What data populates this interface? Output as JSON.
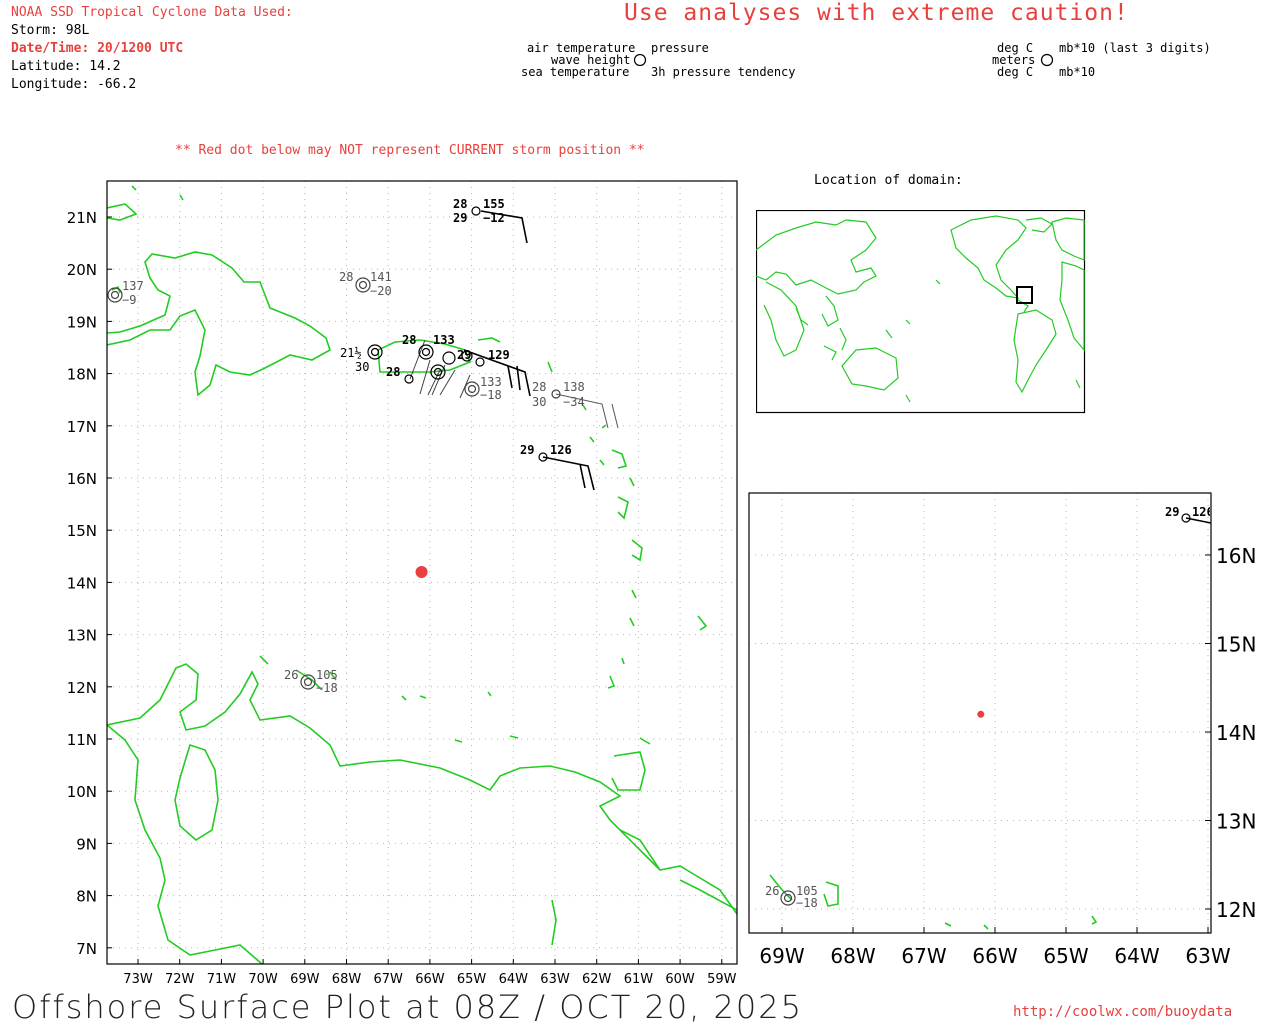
{
  "header": {
    "data_used": "NOAA SSD Tropical Cyclone Data Used:",
    "storm": "Storm: 98L",
    "datetime": "Date/Time: 20/1200 UTC",
    "latitude": "Latitude: 14.2",
    "longitude": "Longitude: -66.2",
    "caution": "Use analyses with extreme caution!"
  },
  "legend": {
    "air_temperature": "air temperature",
    "pressure": "pressure",
    "wave_height": "wave height",
    "sea_temperature": "sea temperature",
    "pressure_tendency": "3h pressure tendency",
    "deg_c_1": "deg C",
    "mb10_last3": "mb*10 (last 3 digits)",
    "meters": "meters",
    "deg_c_2": "deg C",
    "mb10": "mb*10"
  },
  "notice": "** Red dot below may NOT represent CURRENT storm position **",
  "inset_title": "Location of domain:",
  "main_map": {
    "lat_labels": [
      "21N",
      "20N",
      "19N",
      "18N",
      "17N",
      "16N",
      "15N",
      "14N",
      "13N",
      "12N",
      "11N",
      "10N",
      "9N",
      "8N",
      "7N"
    ],
    "lon_labels": [
      "73W",
      "72W",
      "71W",
      "70W",
      "69W",
      "68W",
      "67W",
      "66W",
      "65W",
      "64W",
      "63W",
      "62W",
      "61W",
      "60W",
      "59W"
    ],
    "storm_position": {
      "lat": 14.2,
      "lon": -66.2,
      "color": "#e8403c"
    },
    "land_color": "#22cc22",
    "stations": [
      {
        "air": "28",
        "pres": "155",
        "sea": "29",
        "tend": "−12",
        "bold": true
      },
      {
        "air": "",
        "pres": "137",
        "sea": "",
        "tend": "−9",
        "bold": false
      },
      {
        "air": "28",
        "pres": "141",
        "sea": "",
        "tend": "−20",
        "bold": false
      },
      {
        "air": "21½",
        "pres": "",
        "sea": "30",
        "tend": "",
        "bold": false
      },
      {
        "air": "28",
        "pres": "133",
        "sea": "",
        "tend": "",
        "bold": true
      },
      {
        "air": "29",
        "pres": "129",
        "sea": "",
        "tend": "",
        "bold": true
      },
      {
        "air": "28",
        "pres": "",
        "sea": "",
        "tend": "",
        "bold": true
      },
      {
        "air": "",
        "pres": "133",
        "sea": "",
        "tend": "−18",
        "bold": false
      },
      {
        "air": "28",
        "pres": "138",
        "sea": "30",
        "tend": "−34",
        "bold": false
      },
      {
        "air": "29",
        "pres": "126",
        "sea": "",
        "tend": "",
        "bold": true
      },
      {
        "air": "26",
        "pres": "105",
        "sea": "",
        "tend": "−18",
        "bold": false
      }
    ]
  },
  "zoom_map": {
    "lat_labels": [
      "16N",
      "15N",
      "14N",
      "13N",
      "12N"
    ],
    "lon_labels": [
      "69W",
      "68W",
      "67W",
      "66W",
      "65W",
      "64W",
      "63W"
    ],
    "stations": [
      {
        "air": "29",
        "pres": "126",
        "bold": true
      },
      {
        "air": "26",
        "pres": "105",
        "tend": "−18",
        "bold": false
      }
    ]
  },
  "footer": {
    "title": "Offshore Surface Plot at 08Z / OCT 20, 2025",
    "url": "http://coolwx.com/buoydata"
  }
}
